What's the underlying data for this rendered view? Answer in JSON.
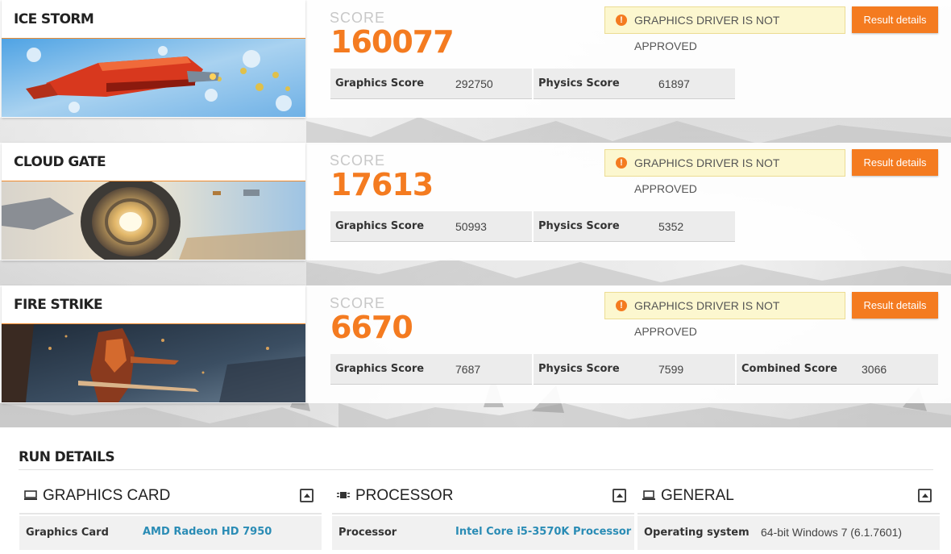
{
  "tests": [
    {
      "name": "ICE STORM",
      "score_label": "SCORE",
      "score": "160077",
      "warning": "GRAPHICS DRIVER IS NOT APPROVED",
      "button": "Result details",
      "subscores": [
        {
          "label": "Graphics Score",
          "value": "292750"
        },
        {
          "label": "Physics Score",
          "value": "61897"
        }
      ]
    },
    {
      "name": "CLOUD GATE",
      "score_label": "SCORE",
      "score": "17613",
      "warning": "GRAPHICS DRIVER IS NOT APPROVED",
      "button": "Result details",
      "subscores": [
        {
          "label": "Graphics Score",
          "value": "50993"
        },
        {
          "label": "Physics Score",
          "value": "5352"
        }
      ]
    },
    {
      "name": "FIRE STRIKE",
      "score_label": "SCORE",
      "score": "6670",
      "warning": "GRAPHICS DRIVER IS NOT APPROVED",
      "button": "Result details",
      "subscores": [
        {
          "label": "Graphics Score",
          "value": "7687"
        },
        {
          "label": "Physics Score",
          "value": "7599"
        },
        {
          "label": "Combined Score",
          "value": "3066"
        }
      ]
    }
  ],
  "run_details": {
    "title": "RUN DETAILS",
    "sections": [
      {
        "heading": "GRAPHICS CARD",
        "icon": "monitor-icon",
        "key": "Graphics Card",
        "value": "AMD Radeon HD 7950"
      },
      {
        "heading": "PROCESSOR",
        "icon": "chip-icon",
        "key": "Processor",
        "value": "Intel Core i5-3570K Processor"
      },
      {
        "heading": "GENERAL",
        "icon": "laptop-icon",
        "key": "Operating system",
        "value": "64-bit Windows 7 (6.1.7601)"
      }
    ]
  },
  "colors": {
    "accent": "#f47b20",
    "warning_bg": "#fcf7cf",
    "link": "#2a8cb5"
  }
}
